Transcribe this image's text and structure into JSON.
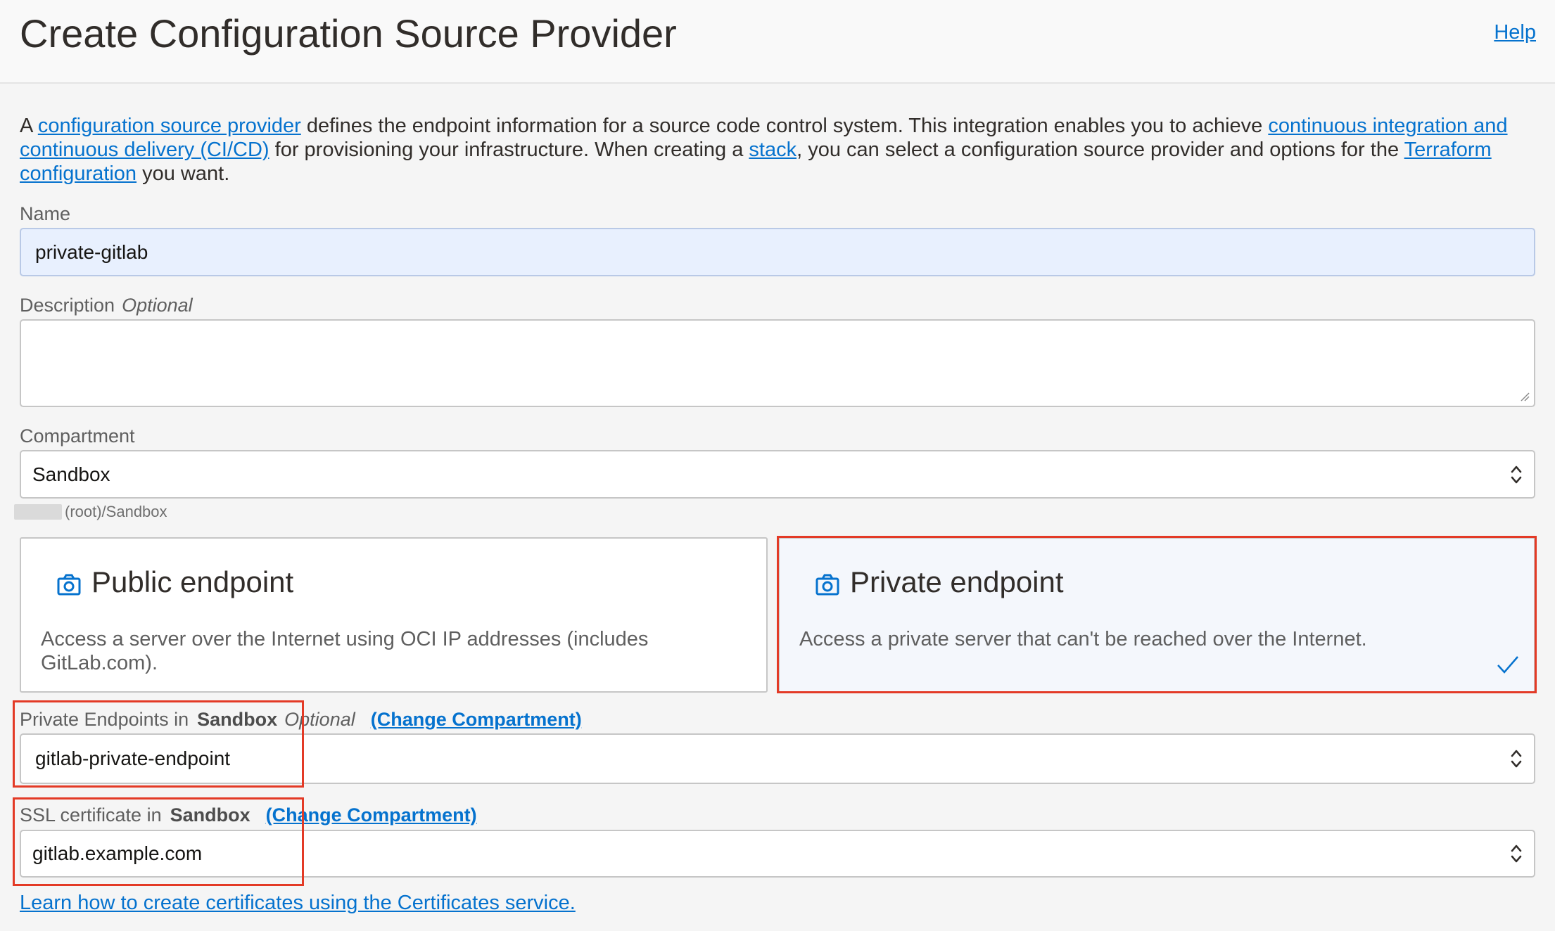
{
  "header": {
    "title": "Create Configuration Source Provider",
    "help_label": "Help"
  },
  "intro": {
    "t1": "A ",
    "link1": "configuration source provider",
    "t2": " defines the endpoint information for a source code control system. This integration enables you to achieve ",
    "link2": "continuous integration and continuous delivery (CI/CD)",
    "t3": " for provisioning your infrastructure. When creating a ",
    "link3": "stack",
    "t4": ", you can select a configuration source provider and options for the ",
    "link4": "Terraform configuration",
    "t5": " you want."
  },
  "form": {
    "name_label": "Name",
    "name_value": "private-gitlab",
    "description_label": "Description",
    "description_optional": "Optional",
    "description_value": "",
    "compartment_label": "Compartment",
    "compartment_value": "Sandbox",
    "compartment_path": "(root)/Sandbox",
    "endpoint_cards": [
      {
        "title": "Public endpoint",
        "description": "Access a server over the Internet using OCI IP addresses (includes GitLab.com).",
        "selected": false
      },
      {
        "title": "Private endpoint",
        "description": "Access a private server that can't be reached over the Internet.",
        "selected": true
      }
    ],
    "private_endpoints_label": "Private Endpoints in",
    "private_endpoints_compartment": "Sandbox",
    "private_endpoints_optional": "Optional",
    "change_compartment_label": "(Change Compartment)",
    "private_endpoints_value": "gitlab-private-endpoint",
    "ssl_label": "SSL certificate in",
    "ssl_compartment": "Sandbox",
    "ssl_value": "gitlab.example.com",
    "learn_link": "Learn how to create certificates using the Certificates service."
  },
  "colors": {
    "link": "#0572ce",
    "highlight": "#e33a26",
    "name_field_bg": "#e8f0fe"
  },
  "icons": [
    "camera-icon",
    "check-icon",
    "select-arrows-icon",
    "resize-grip-icon"
  ]
}
